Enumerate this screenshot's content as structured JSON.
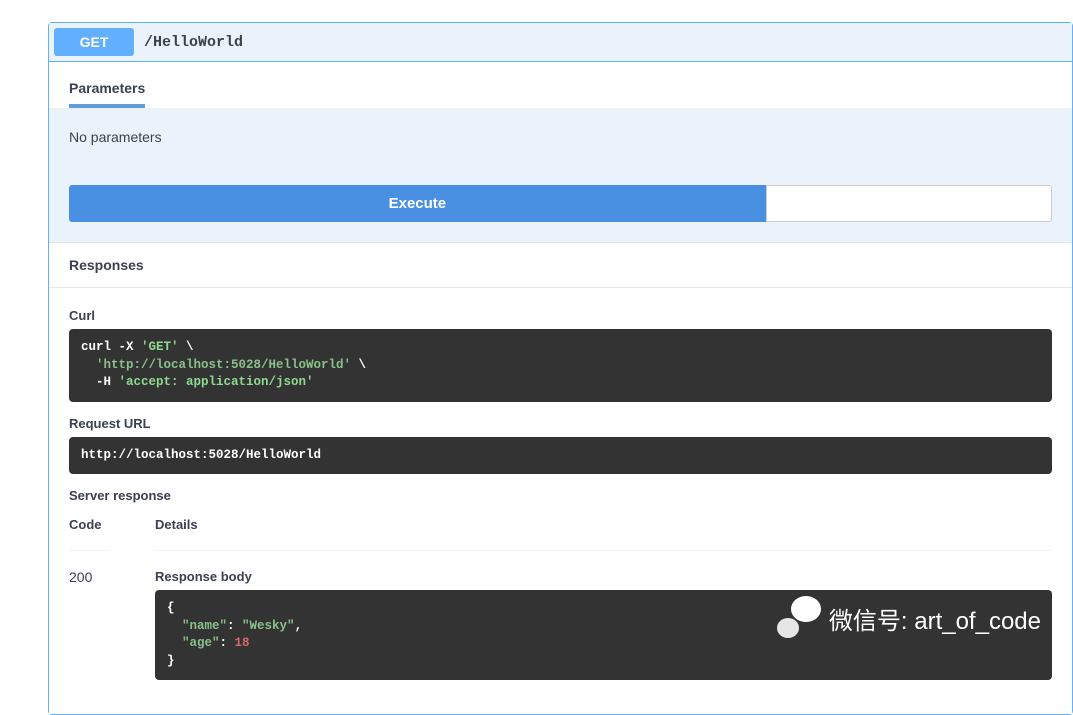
{
  "summary": {
    "method": "GET",
    "path": "/HelloWorld"
  },
  "tabs": {
    "parameters": "Parameters"
  },
  "params": {
    "none": "No parameters"
  },
  "buttons": {
    "execute": "Execute"
  },
  "sections": {
    "responses": "Responses",
    "curl": "Curl",
    "request_url": "Request URL",
    "server_response": "Server response",
    "code": "Code",
    "details": "Details",
    "response_body": "Response body"
  },
  "curl": {
    "line1a": "curl -X ",
    "line1b": "'GET'",
    "line1c": " \\",
    "line2": "  'http://localhost:5028/HelloWorld'",
    "line2end": " \\",
    "line3a": "  -H ",
    "line3b": "'accept: application/json'"
  },
  "request_url": "http://localhost:5028/HelloWorld",
  "response": {
    "code": "200",
    "body": {
      "open": "{",
      "k1": "\"name\"",
      "v1": "\"Wesky\"",
      "k2": "\"age\"",
      "v2": "18",
      "close": "}"
    }
  },
  "watermark": {
    "text": "微信号: art_of_code"
  }
}
